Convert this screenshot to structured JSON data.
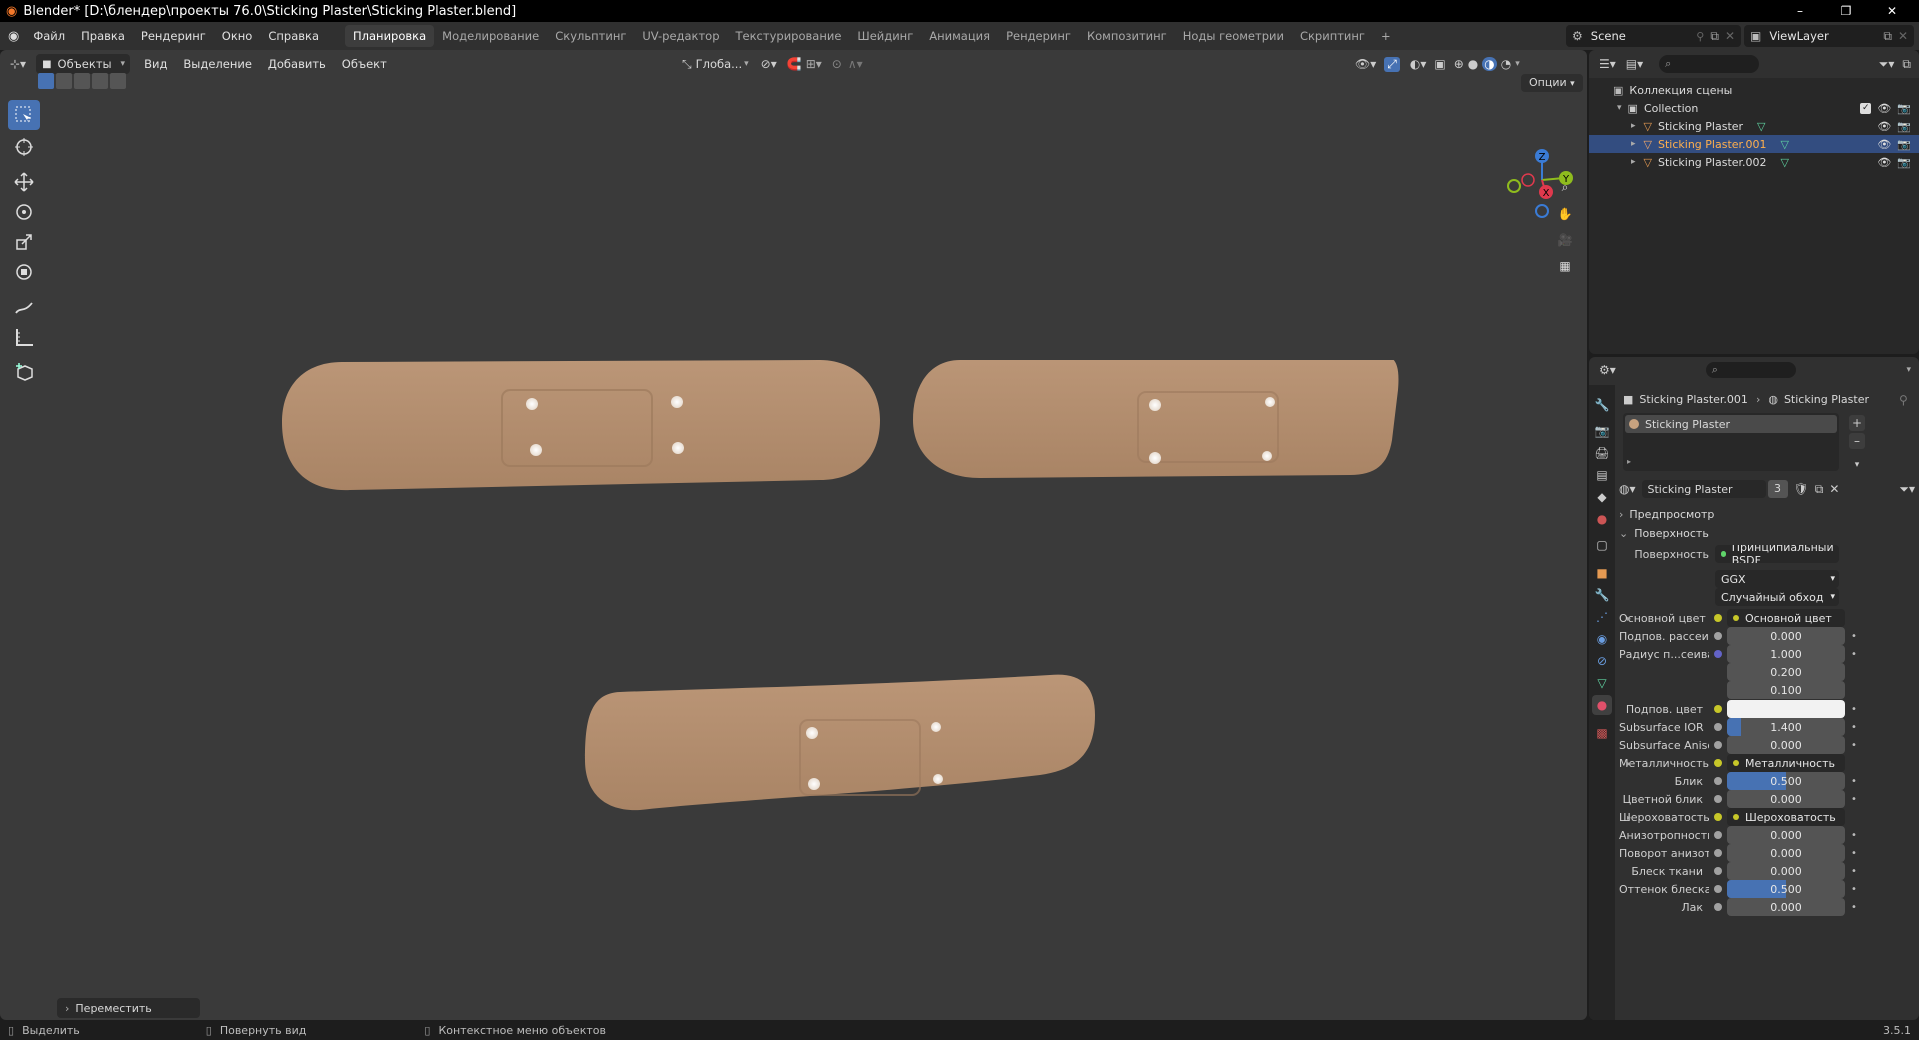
{
  "window": {
    "title": "Blender* [D:\\блендер\\проекты 76.0\\Sticking Plaster\\Sticking Plaster.blend]",
    "minimize": "–",
    "maximize": "❐",
    "close": "✕"
  },
  "menu": [
    "Файл",
    "Правка",
    "Рендеринг",
    "Окно",
    "Справка"
  ],
  "workspaces": [
    "Планировка",
    "Моделирование",
    "Скульптинг",
    "UV-редактор",
    "Текстурирование",
    "Шейдинг",
    "Анимация",
    "Рендеринг",
    "Композитинг",
    "Ноды геометрии",
    "Скриптинг"
  ],
  "workspace_add": "+",
  "scene": {
    "name": "Scene",
    "view_layer": "ViewLayer"
  },
  "viewport": {
    "mode": "Объекты",
    "menus": [
      "Вид",
      "Выделение",
      "Добавить",
      "Объект"
    ],
    "orientation": "Глоба...",
    "options": "Опции",
    "last_operator": "Переместить",
    "axes": {
      "x": "X",
      "y": "Y",
      "z": "Z"
    }
  },
  "outliner": {
    "root": "Коллекция сцены",
    "collection": "Collection",
    "objects": [
      "Sticking Plaster",
      "Sticking Plaster.001",
      "Sticking Plaster.002"
    ]
  },
  "properties": {
    "breadcrumb_object": "Sticking Plaster.001",
    "breadcrumb_material": "Sticking Plaster",
    "slot": "Sticking Plaster",
    "material_name": "Sticking Plaster",
    "users": "3",
    "panel_preview": "Предпросмотр",
    "panel_surface": "Поверхность",
    "surface_label": "Поверхность",
    "surface_value": "Принципиальный BSDF",
    "distribution": "GGX",
    "subsurface_method": "Случайный обход",
    "rows": [
      {
        "label": "Основной цвет",
        "value": "Основной цвет",
        "type": "link"
      },
      {
        "label": "Подпов. рассеива...",
        "value": "0.000",
        "type": "num",
        "fill": 0
      },
      {
        "label": "Радиус п...сеивания",
        "value": "1.000",
        "type": "num",
        "fill": 0
      },
      {
        "label": "",
        "value": "0.200",
        "type": "num",
        "fill": 0
      },
      {
        "label": "",
        "value": "0.100",
        "type": "num",
        "fill": 0
      },
      {
        "label": "Подпов. цвет",
        "value": "",
        "type": "color"
      },
      {
        "label": "Subsurface IOR",
        "value": "1.400",
        "type": "num",
        "fill": 0.12
      },
      {
        "label": "Subsurface Anisotr...",
        "value": "0.000",
        "type": "num",
        "fill": 0
      },
      {
        "label": "Металличность",
        "value": "Металличность",
        "type": "link"
      },
      {
        "label": "Блик",
        "value": "0.500",
        "type": "num",
        "fill": 0.5
      },
      {
        "label": "Цветной блик",
        "value": "0.000",
        "type": "num",
        "fill": 0
      },
      {
        "label": "Шероховатость",
        "value": "Шероховатость",
        "type": "link"
      },
      {
        "label": "Анизотропность",
        "value": "0.000",
        "type": "num",
        "fill": 0
      },
      {
        "label": "Поворот анизотро...",
        "value": "0.000",
        "type": "num",
        "fill": 0
      },
      {
        "label": "Блеск ткани",
        "value": "0.000",
        "type": "num",
        "fill": 0
      },
      {
        "label": "Оттенок блеска тк...",
        "value": "0.500",
        "type": "num",
        "fill": 0.5
      },
      {
        "label": "Лак",
        "value": "0.000",
        "type": "num",
        "fill": 0
      }
    ]
  },
  "status": {
    "select": "Выделить",
    "rotate": "Повернуть вид",
    "context": "Контекстное меню объектов",
    "version": "3.5.1"
  },
  "colors": {
    "accent": "#4772b3",
    "plaster": "#b4906f",
    "viewport_bg": "#3a3a3a"
  }
}
